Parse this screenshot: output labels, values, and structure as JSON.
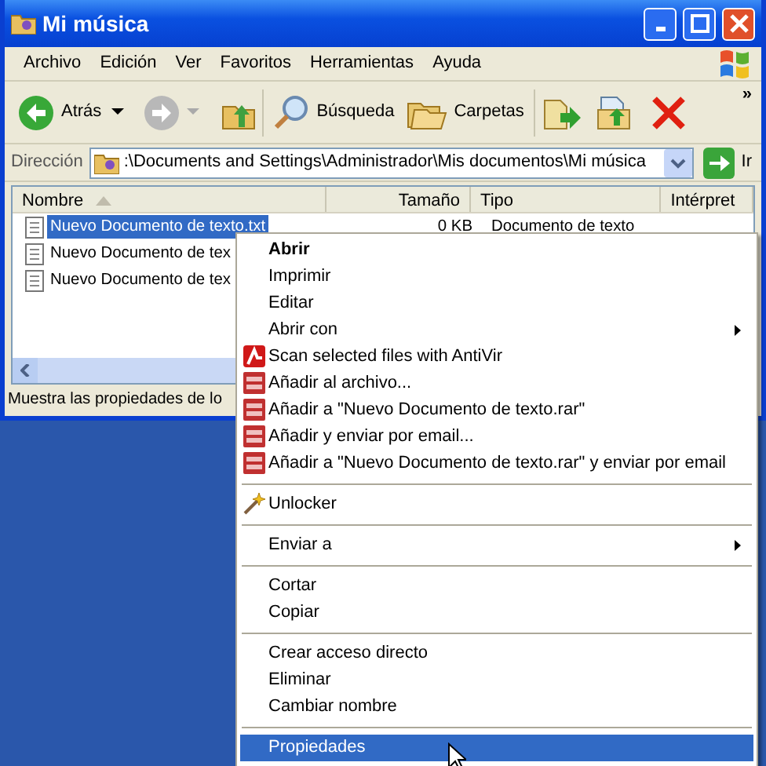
{
  "window": {
    "title": "Mi música"
  },
  "menubar": [
    "Archivo",
    "Edición",
    "Ver",
    "Favoritos",
    "Herramientas",
    "Ayuda"
  ],
  "toolbar": {
    "back": "Atrás",
    "search": "Búsqueda",
    "folders": "Carpetas",
    "more": "»"
  },
  "address": {
    "label": "Dirección",
    "value": ":\\Documents and Settings\\Administrador\\Mis documentos\\Mi música",
    "go": "Ir"
  },
  "columns": [
    "Nombre",
    "Tamaño",
    "Tipo",
    "Intérpret"
  ],
  "files": [
    {
      "name": "Nuevo Documento de texto.txt",
      "size": "0 KB",
      "type": "Documento de texto",
      "selected": true
    },
    {
      "name": "Nuevo Documento de tex",
      "selected": false
    },
    {
      "name": "Nuevo Documento de tex",
      "selected": false
    }
  ],
  "status_bar": "Muestra las propiedades de lo",
  "context_menu": [
    {
      "kind": "item",
      "label": "Abrir",
      "default": true,
      "submenu": false,
      "selected": false
    },
    {
      "kind": "item",
      "label": "Imprimir",
      "default": false,
      "submenu": false,
      "selected": false
    },
    {
      "kind": "item",
      "label": "Editar",
      "default": false,
      "submenu": false,
      "selected": false
    },
    {
      "kind": "item",
      "label": "Abrir con",
      "default": false,
      "submenu": true,
      "selected": false
    },
    {
      "kind": "antivir",
      "label": "Scan selected files with AntiVir",
      "default": false,
      "submenu": false,
      "selected": false
    },
    {
      "kind": "archive",
      "label": "Añadir al archivo...",
      "default": false,
      "submenu": false,
      "selected": false
    },
    {
      "kind": "archive",
      "label": "Añadir a \"Nuevo Documento de texto.rar\"",
      "default": false,
      "submenu": false,
      "selected": false
    },
    {
      "kind": "archive",
      "label": "Añadir y enviar por email...",
      "default": false,
      "submenu": false,
      "selected": false
    },
    {
      "kind": "archive",
      "label": "Añadir a \"Nuevo Documento de texto.rar\" y enviar por email",
      "default": false,
      "submenu": false,
      "selected": false
    },
    {
      "kind": "separator"
    },
    {
      "kind": "wand",
      "label": "Unlocker",
      "default": false,
      "submenu": false,
      "selected": false
    },
    {
      "kind": "separator"
    },
    {
      "kind": "item",
      "label": "Enviar a",
      "default": false,
      "submenu": true,
      "selected": false
    },
    {
      "kind": "separator"
    },
    {
      "kind": "item",
      "label": "Cortar",
      "default": false,
      "submenu": false,
      "selected": false
    },
    {
      "kind": "item",
      "label": "Copiar",
      "default": false,
      "submenu": false,
      "selected": false
    },
    {
      "kind": "separator"
    },
    {
      "kind": "item",
      "label": "Crear acceso directo",
      "default": false,
      "submenu": false,
      "selected": false
    },
    {
      "kind": "item",
      "label": "Eliminar",
      "default": false,
      "submenu": false,
      "selected": false
    },
    {
      "kind": "item",
      "label": "Cambiar nombre",
      "default": false,
      "submenu": false,
      "selected": false
    },
    {
      "kind": "separator"
    },
    {
      "kind": "item",
      "label": "Propiedades",
      "default": false,
      "submenu": false,
      "selected": true
    }
  ]
}
